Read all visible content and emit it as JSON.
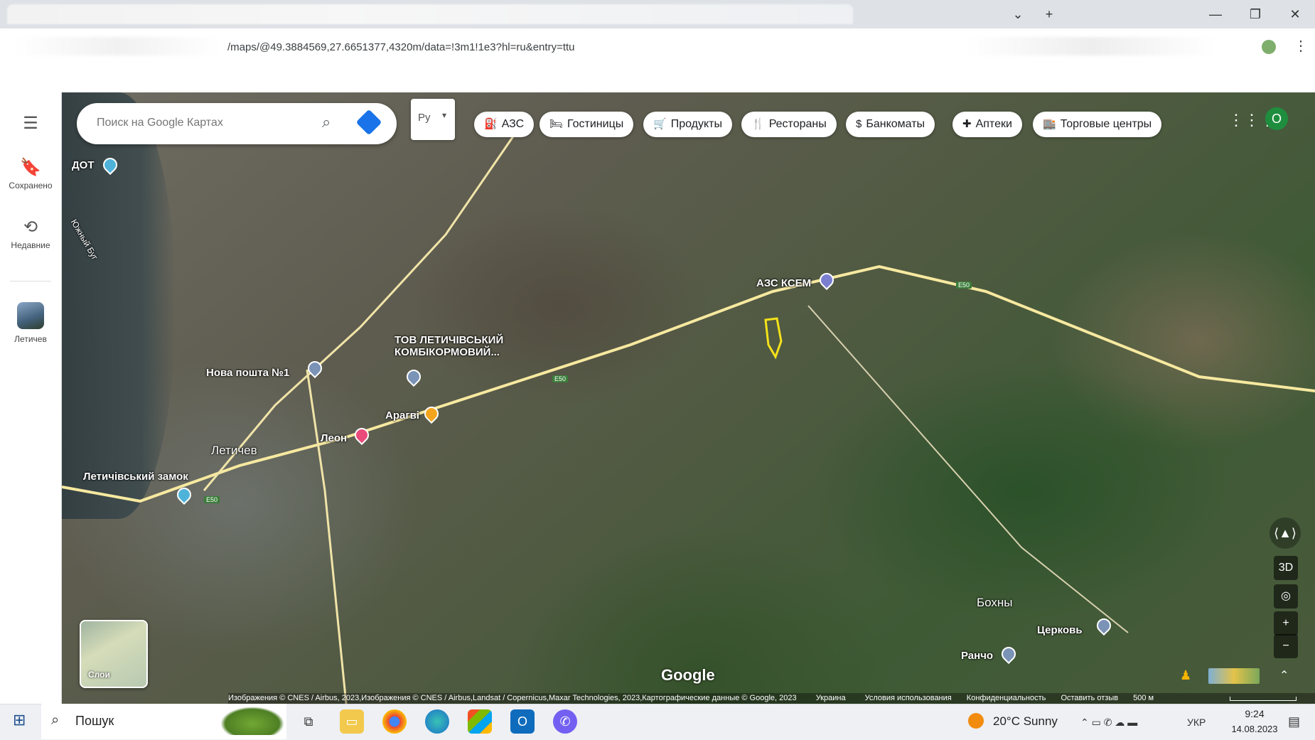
{
  "browser": {
    "url": "/maps/@49.3884569,27.6651377,4320m/data=!3m1!1e3?hl=ru&entry=ttu",
    "new_tab": "+",
    "minimize": "—",
    "restore": "❐",
    "close": "✕",
    "dropdown": "⌄",
    "menu": "⋮"
  },
  "rail": {
    "menu_icon": "hamburger-icon",
    "saved_label": "Сохранено",
    "recent_label": "Недавние",
    "place_label": "Летичев"
  },
  "search": {
    "placeholder": "Поиск на Google Картах"
  },
  "lang_toggle": "Ру",
  "chips": [
    {
      "label": "АЗС",
      "icon": "gas-pump-icon",
      "glyph": "⛽"
    },
    {
      "label": "Гостиницы",
      "icon": "bed-icon",
      "glyph": "🛏"
    },
    {
      "label": "Продукты",
      "icon": "cart-icon",
      "glyph": "🛒"
    },
    {
      "label": "Рестораны",
      "icon": "fork-knife-icon",
      "glyph": "🍴"
    },
    {
      "label": "Банкоматы",
      "icon": "atm-icon",
      "glyph": "$"
    },
    {
      "label": "Аптеки",
      "icon": "pharmacy-icon",
      "glyph": "✚"
    },
    {
      "label": "Торговые центры",
      "icon": "store-icon",
      "glyph": "🏬"
    }
  ],
  "account_initial": "O",
  "map_labels": {
    "dot": "ДОТ",
    "river": "Южный Буг",
    "nova_poshta": "Нова пошта №1",
    "kombikorm": "ТОВ ЛЕТИЧІВСЬКИЙ КОМБІКОРМОВИЙ...",
    "aragvi": "Арагві",
    "leon": "Леон",
    "letichev": "Летичев",
    "zamok": "Летичівський замок",
    "azs_ksem": "АЗС КСЕМ",
    "bokhny": "Бохны",
    "tserkov": "Церковь",
    "rancho": "Ранчо",
    "road": "E50"
  },
  "controls": {
    "three_d": "3D",
    "zoom_in": "+",
    "zoom_out": "−",
    "layers_label": "Слои",
    "google": "Google"
  },
  "attribution": {
    "text": "Изображения © CNES / Airbus, 2023,Изображения © CNES / Airbus,Landsat / Copernicus,Maxar Technologies, 2023,Картографические данные © Google, 2023",
    "country": "Украина",
    "terms": "Условия использования",
    "privacy": "Конфиденциальность",
    "feedback": "Оставить отзыв",
    "scale": "500 м"
  },
  "taskbar": {
    "search_text": "Пошук",
    "weather": "20°C  Sunny",
    "lang": "УКР",
    "time": "9:24",
    "date": "14.08.2023"
  },
  "colors": {
    "accent": "#1a73e8",
    "account": "#1e8e3e",
    "marker_yellow": "#f5e21a"
  }
}
